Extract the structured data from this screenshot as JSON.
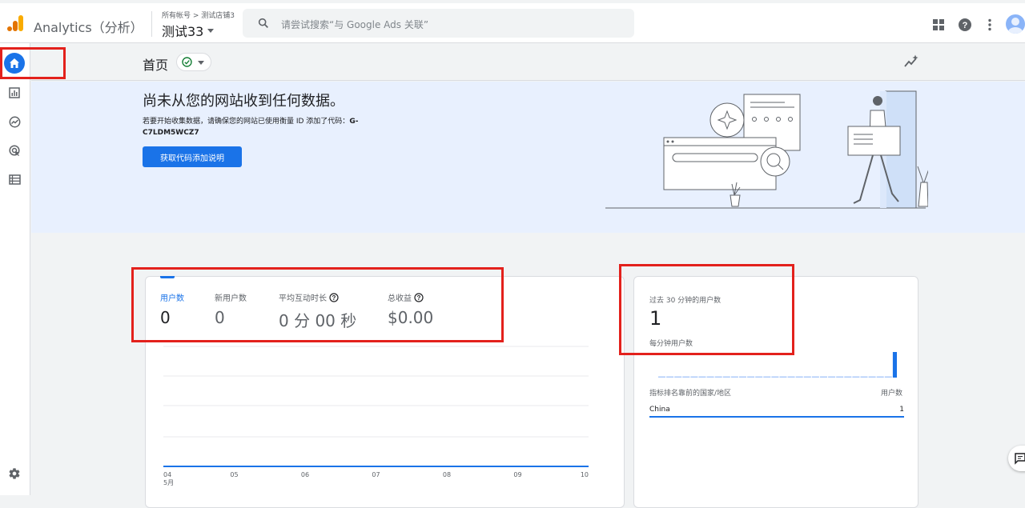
{
  "app": {
    "brand": "Analytics（分析）",
    "account_path": "所有帐号 > 测试店铺3",
    "property_name": "测试33",
    "search_placeholder": "请尝试搜索“与 Google Ads 关联”"
  },
  "page": {
    "title": "首页"
  },
  "banner": {
    "title": "尚未从您的网站收到任何数据。",
    "desc_prefix": "若要开始收集数据，请确保您的网站已使用衡量 ID 添加了代码：",
    "measurement_id": "G-C7LDM5WCZ7",
    "button_label": "获取代码添加说明"
  },
  "metrics": [
    {
      "label": "用户数",
      "value": "0",
      "help": false
    },
    {
      "label": "新用户数",
      "value": "0",
      "help": false
    },
    {
      "label": "平均互动时长",
      "value": "0 分 00 秒",
      "help": true
    },
    {
      "label": "总收益",
      "value": "$0.00",
      "help": true
    }
  ],
  "chart_data": {
    "type": "line",
    "x": [
      "04",
      "05",
      "06",
      "07",
      "08",
      "09",
      "10"
    ],
    "x_sublabel": "5月",
    "series": [
      {
        "values": [
          0,
          0,
          0,
          0,
          0,
          0,
          0
        ]
      }
    ]
  },
  "realtime": {
    "label": "过去 30 分钟的用户数",
    "value": "1",
    "per_minute_label": "每分钟用户数",
    "per_minute": [
      0,
      0,
      0,
      0,
      0,
      0,
      0,
      0,
      0,
      0,
      0,
      0,
      0,
      0,
      0,
      0,
      0,
      0,
      0,
      0,
      0,
      0,
      0,
      0,
      0,
      0,
      0,
      0,
      0,
      1
    ],
    "table_header_left": "指标排名靠前的国家/地区",
    "table_header_right": "用户数",
    "rows": [
      {
        "country": "China",
        "users": "1"
      }
    ]
  },
  "colors": {
    "accent": "#1a73e8",
    "annotation_red": "#e3211c",
    "banner_bg": "#e8f0fe"
  }
}
